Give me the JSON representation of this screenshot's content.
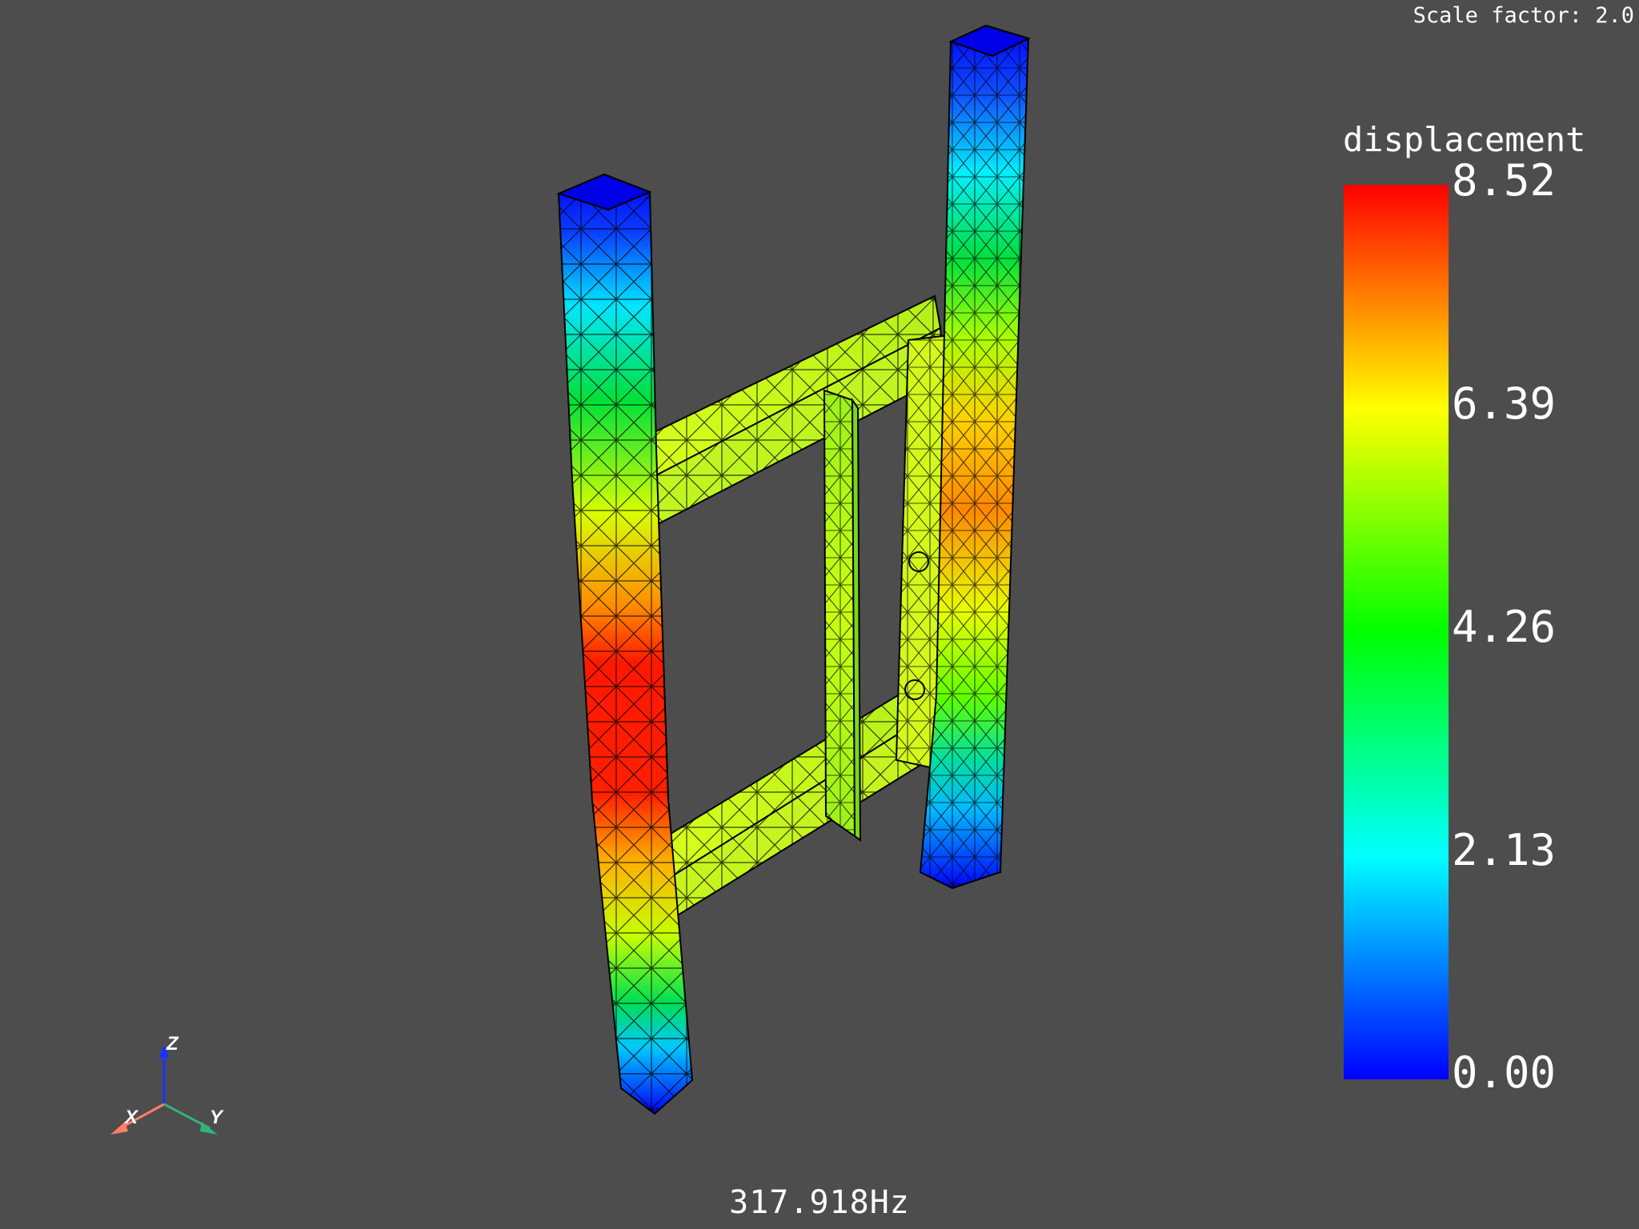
{
  "viewport": {
    "scale_factor_text": "Scale factor: 2.0",
    "frequency_text": "317.918Hz",
    "background_color": "#4d4d4d",
    "mesh_edge_color": "#000000"
  },
  "colorbar": {
    "title": "displacement",
    "ticks": [
      "8.52",
      "6.39",
      "4.26",
      "2.13",
      "0.00"
    ],
    "min": 0.0,
    "max": 8.52,
    "colormap": "jet",
    "stops": [
      "#0000ff",
      "#00ffff",
      "#00ff00",
      "#ffff00",
      "#ff0000"
    ]
  },
  "axes_widget": {
    "x_label": "X",
    "y_label": "Y",
    "z_label": "Z",
    "x_color": "#ff7f66",
    "y_color": "#33b378",
    "z_color": "#1a33ff"
  }
}
